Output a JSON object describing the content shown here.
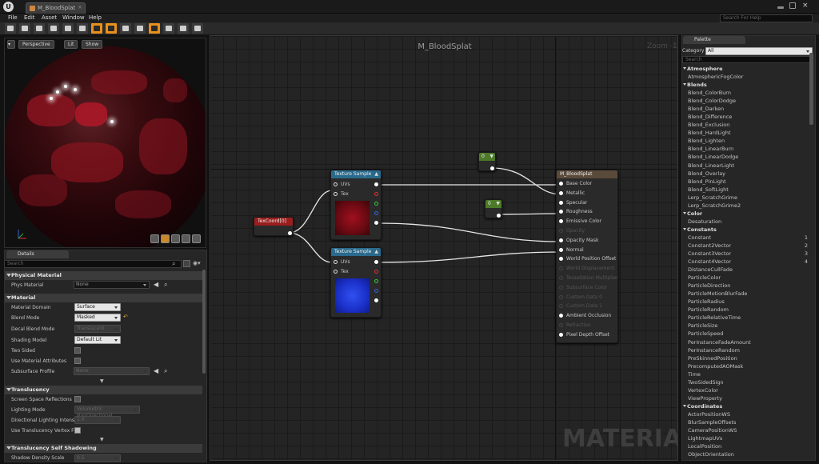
{
  "window": {
    "tab_title": "M_BloodSplat",
    "search_help_placeholder": "Search For Help"
  },
  "menu": [
    "File",
    "Edit",
    "Asset",
    "Window",
    "Help"
  ],
  "viewport": {
    "perspective": "Perspective",
    "lit": "Lit",
    "show": "Show"
  },
  "details": {
    "tab": "Details",
    "search_placeholder": "Search",
    "physical_material": {
      "title": "Physical Material",
      "phys_material_label": "Phys Material",
      "phys_material_value": "None"
    },
    "material": {
      "title": "Material",
      "domain_label": "Material Domain",
      "domain_value": "Surface",
      "blend_label": "Blend Mode",
      "blend_value": "Masked",
      "decal_label": "Decal Blend Mode",
      "decal_value": "Translucent",
      "shading_label": "Shading Model",
      "shading_value": "Default Lit",
      "two_sided_label": "Two Sided",
      "use_mat_attr_label": "Use Material Attributes",
      "subsurface_label": "Subsurface Profile",
      "subsurface_value": "None"
    },
    "translucency": {
      "title": "Translucency",
      "ssr_label": "Screen Space Reflections",
      "lighting_mode_label": "Lighting Mode",
      "lighting_mode_value": "Volumetric NonDirectional",
      "dir_light_label": "Directional Lighting Intensity",
      "dir_light_value": "1.0",
      "vertex_fog_label": "Use Translucency Vertex Fog"
    },
    "self_shadowing": {
      "title": "Translucency Self Shadowing",
      "shadow_density_label": "Shadow Density Scale",
      "shadow_density_value": "0.5"
    }
  },
  "graph": {
    "title": "M_BloodSplat",
    "zoom": "Zoom -1",
    "watermark": "MATERIAL",
    "texcoord": "TexCoord[0]",
    "tex_sample_1": "Texture Sample",
    "tex_sample_2": "Texture Sample",
    "uvs": "UVs",
    "tex": "Tex",
    "const_a": "0",
    "const_b": "0",
    "result_node": {
      "title": "M_BloodSplat",
      "pins": [
        "Base Color",
        "Metallic",
        "Specular",
        "Roughness",
        "Emissive Color",
        "Opacity",
        "Opacity Mask",
        "Normal",
        "World Position Offset",
        "World Displacement",
        "Tessellation Multiplier",
        "Subsurface Color",
        "Custom Data 0",
        "Custom Data 1",
        "Ambient Occlusion",
        "Refraction",
        "Pixel Depth Offset"
      ]
    }
  },
  "palette": {
    "tab": "Palette",
    "category_label": "Category",
    "category_value": "All",
    "search_placeholder": "Search",
    "categories": [
      {
        "name": "Atmosphere",
        "items": [
          {
            "label": "AtmosphericFogColor"
          }
        ]
      },
      {
        "name": "Blends",
        "items": [
          {
            "label": "Blend_ColorBurn"
          },
          {
            "label": "Blend_ColorDodge"
          },
          {
            "label": "Blend_Darken"
          },
          {
            "label": "Blend_Difference"
          },
          {
            "label": "Blend_Exclusion"
          },
          {
            "label": "Blend_HardLight"
          },
          {
            "label": "Blend_Lighten"
          },
          {
            "label": "Blend_LinearBurn"
          },
          {
            "label": "Blend_LinearDodge"
          },
          {
            "label": "Blend_LinearLight"
          },
          {
            "label": "Blend_Overlay"
          },
          {
            "label": "Blend_PinLight"
          },
          {
            "label": "Blend_SoftLight"
          },
          {
            "label": "Lerp_ScratchGrime"
          },
          {
            "label": "Lerp_ScratchGrime2"
          }
        ]
      },
      {
        "name": "Color",
        "items": [
          {
            "label": "Desaturation"
          }
        ]
      },
      {
        "name": "Constants",
        "items": [
          {
            "label": "Constant",
            "hotkey": "1"
          },
          {
            "label": "Constant2Vector",
            "hotkey": "2"
          },
          {
            "label": "Constant3Vector",
            "hotkey": "3"
          },
          {
            "label": "Constant4Vector",
            "hotkey": "4"
          },
          {
            "label": "DistanceCullFade"
          },
          {
            "label": "ParticleColor"
          },
          {
            "label": "ParticleDirection"
          },
          {
            "label": "ParticleMotionBlurFade"
          },
          {
            "label": "ParticleRadius"
          },
          {
            "label": "ParticleRandom"
          },
          {
            "label": "ParticleRelativeTime"
          },
          {
            "label": "ParticleSize"
          },
          {
            "label": "ParticleSpeed"
          },
          {
            "label": "PerInstanceFadeAmount"
          },
          {
            "label": "PerInstanceRandom"
          },
          {
            "label": "PreSkinnedPosition"
          },
          {
            "label": "PrecomputedAOMask"
          },
          {
            "label": "Time"
          },
          {
            "label": "TwoSidedSign"
          },
          {
            "label": "VertexColor"
          },
          {
            "label": "ViewProperty"
          }
        ]
      },
      {
        "name": "Coordinates",
        "items": [
          {
            "label": "ActorPositionWS"
          },
          {
            "label": "BlurSampleOffsets"
          },
          {
            "label": "CameraPositionWS"
          },
          {
            "label": "LightmapUVs"
          },
          {
            "label": "LocalPosition"
          },
          {
            "label": "ObjectOrientation"
          }
        ]
      }
    ]
  },
  "colors": {
    "accent": "#e8901c",
    "texture_header": "#2a6a8c",
    "texcoord_header": "#9a1e1e",
    "constant_header": "#4d7a2a",
    "result_header": "#5a4a3a"
  }
}
